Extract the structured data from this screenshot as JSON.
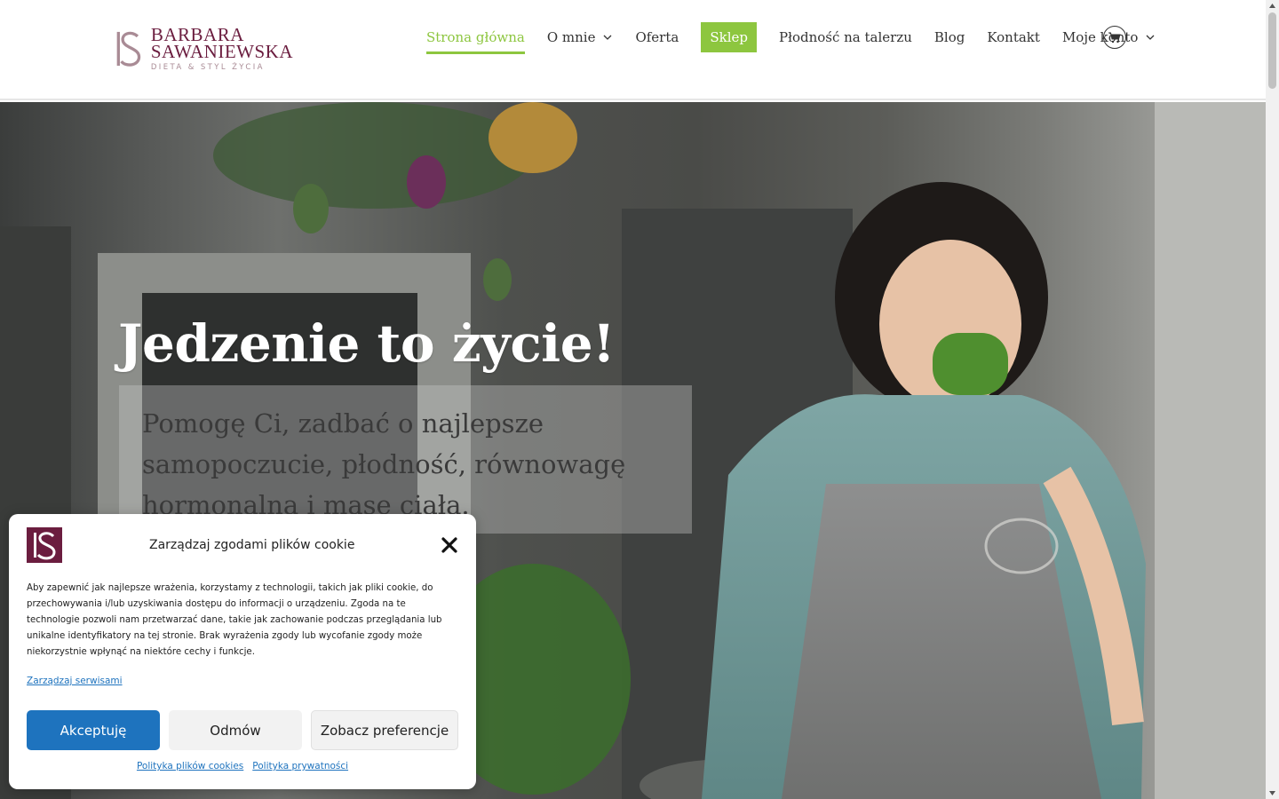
{
  "brand": {
    "line1": "BARBARA",
    "line2": "SAWANIEWSKA",
    "tagline": "DIETA & STYL ŻYCIA",
    "color_primary": "#6b1d3f",
    "color_accent": "#8dc63f"
  },
  "nav": {
    "items": [
      {
        "label": "Strona główna",
        "active": true
      },
      {
        "label": "O mnie",
        "has_dropdown": true
      },
      {
        "label": "Oferta"
      },
      {
        "label": "Sklep",
        "highlight": true
      },
      {
        "label": "Płodność na talerzu"
      },
      {
        "label": "Blog"
      },
      {
        "label": "Kontakt"
      },
      {
        "label": "Moje konto",
        "has_dropdown": true
      }
    ],
    "cart_icon": "cart-icon"
  },
  "hero": {
    "title": "Jedzenie to życie!",
    "subtitle": "Pomogę Ci, zadbać o najlepsze samopoczucie, płodność, równowagę hormonalną i masę ciała."
  },
  "cookie": {
    "title": "Zarządzaj zgodami plików cookie",
    "text": "Aby zapewnić jak najlepsze wrażenia, korzystamy z technologii, takich jak pliki cookie, do przechowywania i/lub uzyskiwania dostępu do informacji o urządzeniu. Zgoda na te technologie pozwoli nam przetwarzać dane, takie jak zachowanie podczas przeglądania lub unikalne identyfikatory na tej stronie. Brak wyrażenia zgody lub wycofanie zgody może niekorzystnie wpłynąć na niektóre cechy i funkcje.",
    "manage_link": "Zarządzaj serwisami",
    "accept": "Akceptuję",
    "deny": "Odmów",
    "preferences": "Zobacz preferencje",
    "cookie_policy": "Polityka plików cookies",
    "privacy_policy": "Polityka prywatności"
  }
}
